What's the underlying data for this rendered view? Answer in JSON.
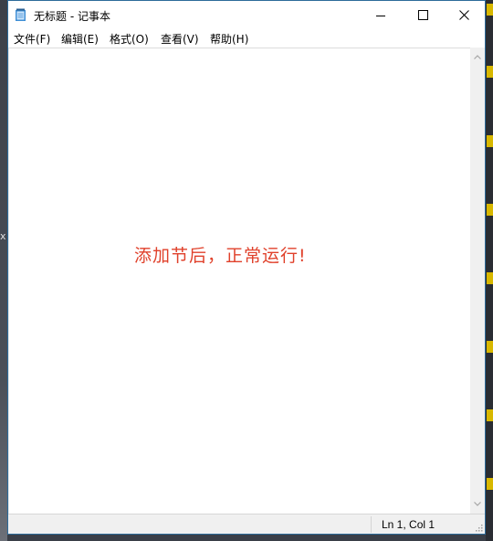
{
  "window": {
    "title": "无标题 - 记事本",
    "icon": "notepad-icon"
  },
  "window_controls": {
    "minimize": "minimize-icon",
    "maximize": "maximize-icon",
    "close": "close-icon"
  },
  "menu": {
    "items": [
      {
        "label": "文件(F)"
      },
      {
        "label": "编辑(E)"
      },
      {
        "label": "格式(O)"
      },
      {
        "label": "查看(V)"
      },
      {
        "label": "帮助(H)"
      }
    ]
  },
  "editor": {
    "text": "添加节后，正常运行!",
    "text_color": "#e0412b"
  },
  "statusbar": {
    "position": "Ln 1, Col 1"
  },
  "desktop": {
    "left_glyph": "x"
  }
}
